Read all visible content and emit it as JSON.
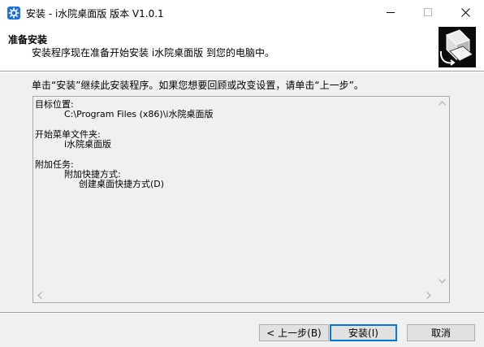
{
  "window": {
    "title": "安装 - i水院桌面版 版本 V1.0.1"
  },
  "header": {
    "title": "准备安装",
    "subtitle": "安装程序现在准备开始安装 i水院桌面版 到您的电脑中。",
    "logo_icon": "computer-install-icon"
  },
  "content": {
    "instruction": "单击“安装”继续此安装程序。如果您想要回顾或改变设置，请单击“上一步”。",
    "memo": {
      "dest_label": "目标位置:",
      "dest_value": "C:\\Program Files (x86)\\i水院桌面版",
      "startmenu_label": "开始菜单文件夹:",
      "startmenu_value": "i水院桌面版",
      "tasks_label": "附加任务:",
      "tasks_group": "附加快捷方式:",
      "tasks_item": "创建桌面快捷方式(D)"
    }
  },
  "buttons": {
    "back": "< 上一步(B)",
    "install": "安装(I)",
    "cancel": "取消"
  },
  "colors": {
    "accent": "#0078d7",
    "panel": "#f0f0f0",
    "button_face": "#e1e1e1"
  }
}
